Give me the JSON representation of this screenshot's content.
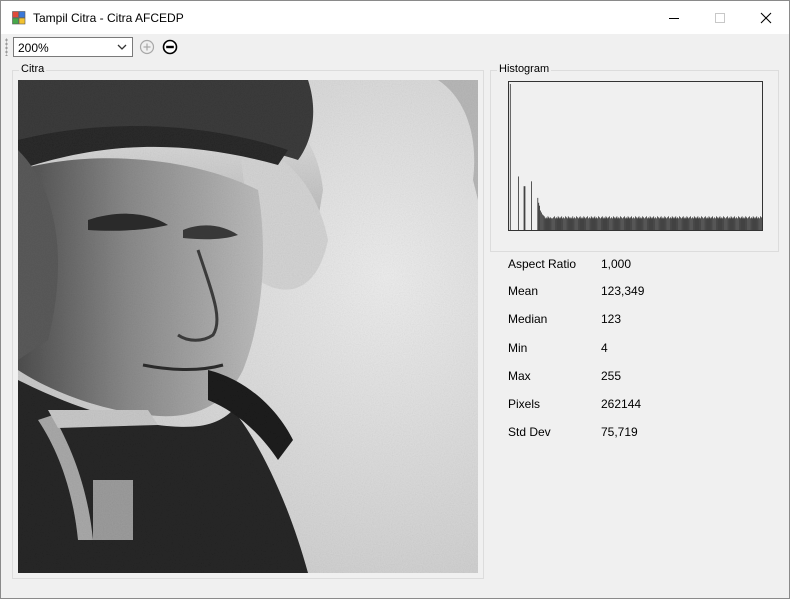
{
  "window": {
    "title": "Tampil Citra - Citra AFCEDP"
  },
  "toolbar": {
    "zoom_value": "200%"
  },
  "groups": {
    "citra_label": "Citra",
    "histogram_label": "Histogram"
  },
  "histogram": {
    "values": [
      0,
      150,
      0,
      0,
      0,
      0,
      0,
      0,
      0,
      0,
      55,
      0,
      0,
      0,
      0,
      0,
      45,
      45,
      0,
      0,
      0,
      0,
      0,
      0,
      50,
      0,
      0,
      0,
      0,
      0,
      0,
      33,
      28,
      25,
      20,
      18,
      16,
      15,
      14,
      12,
      13,
      12,
      14,
      13,
      12,
      13,
      12,
      12,
      13,
      14,
      12,
      13,
      12,
      14,
      13,
      12,
      13,
      14,
      12,
      13,
      12,
      14,
      13,
      12,
      14,
      13,
      12,
      13,
      12,
      14,
      12,
      13,
      12,
      14,
      13,
      12,
      13,
      14,
      12,
      13,
      12,
      14,
      13,
      12,
      13,
      14,
      12,
      13,
      12,
      14,
      13,
      12,
      13,
      14,
      12,
      13,
      12,
      14,
      13,
      12,
      13,
      14,
      12,
      13,
      12,
      14,
      13,
      12,
      13,
      14,
      12,
      13,
      12,
      14,
      13,
      12,
      13,
      14,
      12,
      13,
      12,
      14,
      13,
      12,
      13,
      14,
      12,
      13,
      12,
      14,
      13,
      12,
      13,
      14,
      12,
      13,
      12,
      14,
      13,
      12,
      13,
      14,
      12,
      13,
      12,
      14,
      13,
      12,
      13,
      14,
      12,
      13,
      12,
      14,
      13,
      12,
      13,
      14,
      12,
      13,
      12,
      14,
      13,
      12,
      13,
      14,
      12,
      13,
      12,
      14,
      13,
      12,
      13,
      14,
      12,
      13,
      12,
      14,
      13,
      12,
      13,
      14,
      12,
      13,
      12,
      14,
      13,
      12,
      13,
      14,
      12,
      13,
      12,
      14,
      13,
      12,
      13,
      14,
      12,
      13,
      12,
      14,
      13,
      12,
      13,
      14,
      12,
      13,
      12,
      14,
      13,
      12,
      13,
      14,
      12,
      13,
      12,
      14,
      13,
      12,
      13,
      14,
      12,
      13,
      12,
      14,
      13,
      12,
      13,
      14,
      12,
      13,
      12,
      14,
      13,
      12,
      13,
      14,
      12,
      13,
      12,
      14,
      13,
      12,
      13,
      14,
      12,
      13,
      12,
      14,
      13,
      12,
      13,
      14,
      12,
      13,
      12,
      14,
      13,
      12,
      13,
      14,
      12,
      13,
      12,
      14,
      13,
      12,
      13,
      14,
      12,
      13,
      12,
      14,
      13
    ]
  },
  "stats": [
    {
      "label": "Aspect Ratio",
      "value": "1,000"
    },
    {
      "label": "Mean",
      "value": "123,349"
    },
    {
      "label": "Median",
      "value": "123"
    },
    {
      "label": "Min",
      "value": "4"
    },
    {
      "label": "Max",
      "value": "255"
    },
    {
      "label": "Pixels",
      "value": "262144"
    },
    {
      "label": "Std Dev",
      "value": "75,719"
    }
  ]
}
